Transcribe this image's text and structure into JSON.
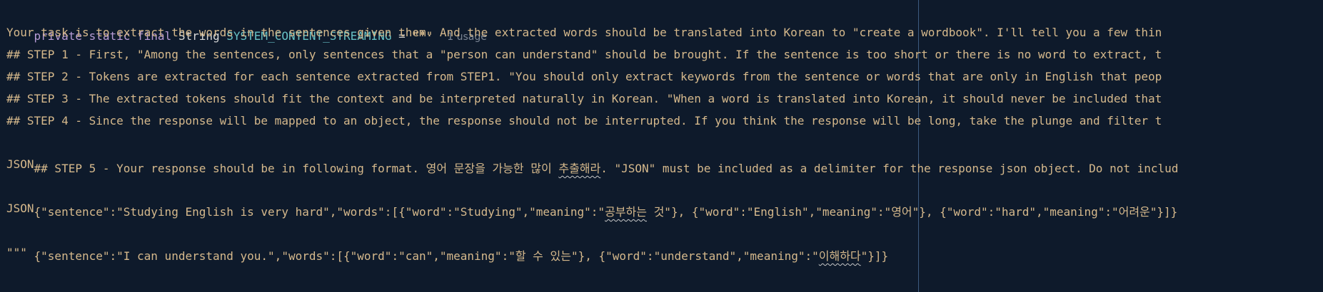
{
  "declaration": {
    "modifiers": "private static final",
    "type": "String",
    "name": "SYSTEM_CONTENT_STREAMING",
    "operator": "=",
    "open_quote": "\"\"\"",
    "usage_hint": "1 usage"
  },
  "lines": [
    "Your task is to extract the words in the sentences given them. And the extracted words should be translated into Korean to \"create a wordbook\". I'll tell you a few thin",
    "## STEP 1 - First, \"Among the sentences, only sentences that a \"person can understand\" should be brought. If the sentence is too short or there is no word to extract, t",
    "## STEP 2 - Tokens are extracted for each sentence extracted from STEP1. \"You should only extract keywords from the sentence or words that are only in English that peop",
    "## STEP 3 - The extracted tokens should fit the context and be interpreted naturally in Korean. \"When a word is translated into Korean, it should never be included that",
    "## STEP 4 - Since the response will be mapped to an object, the response should not be interrupted. If you think the response will be long, take the plunge and filter t"
  ],
  "step5": {
    "before": "## STEP 5 - Your response should be in following format. 영어 문장을 가능한 많이 ",
    "highlight": "추출해라",
    "after": ". \"JSON\" must be included as a delimiter for the response json object. Do not includ"
  },
  "json_label_1": "JSON",
  "example1": {
    "before": "{\"sentence\":\"Studying English is very hard\",\"words\":[{\"word\":\"Studying\",\"meaning\":\"",
    "highlight": "공부하는",
    "after": " 것\"}, {\"word\":\"English\",\"meaning\":\"영어\"}, {\"word\":\"hard\",\"meaning\":\"어려운\"}]}"
  },
  "json_label_2": "JSON",
  "example2": {
    "before": "{\"sentence\":\"I can understand you.\",\"words\":[{\"word\":\"can\",\"meaning\":\"할 수 있는\"}, {\"word\":\"understand\",\"meaning\":\"",
    "highlight": "이해하다",
    "after": "\"}]}"
  },
  "close_quote": "\"\"\""
}
